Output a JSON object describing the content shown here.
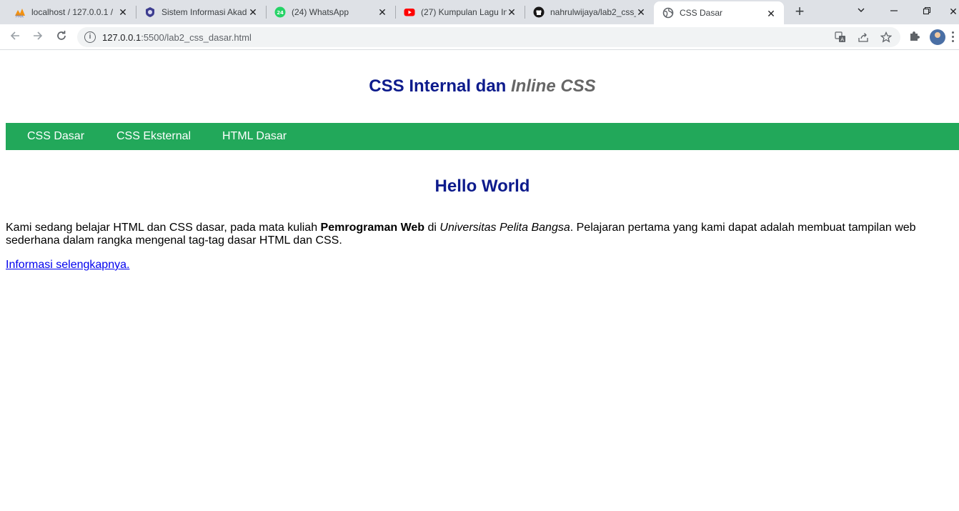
{
  "browser": {
    "tabs": [
      {
        "title": "localhost / 127.0.0.1 / ",
        "favicon": "phpmyadmin-icon",
        "active": false
      },
      {
        "title": "Sistem Informasi Akad",
        "favicon": "university-icon",
        "active": false
      },
      {
        "title": "(24) WhatsApp",
        "favicon": "whatsapp-icon",
        "badge": "24",
        "active": false
      },
      {
        "title": "(27) Kumpulan Lagu In",
        "favicon": "youtube-icon",
        "active": false
      },
      {
        "title": "nahrulwijaya/lab2_css_",
        "favicon": "github-icon",
        "active": false
      },
      {
        "title": "CSS Dasar",
        "favicon": "globe-icon",
        "active": true
      }
    ],
    "url_host": "127.0.0.1",
    "url_rest": ":5500/lab2_css_dasar.html",
    "accent_green": "#22a85a",
    "title_blue": "#0d1b8c"
  },
  "page": {
    "title_part1": "CSS Internal dan ",
    "title_part2": "Inline CSS",
    "nav": [
      "CSS Dasar",
      "CSS Eksternal",
      "HTML Dasar"
    ],
    "heading": "Hello World",
    "para_1": "Kami sedang belajar HTML dan CSS dasar, pada mata kuliah ",
    "para_bold": "Pemrograman Web",
    "para_2": " di ",
    "para_italic": "Universitas Pelita Bangsa",
    "para_3": ". Pelajaran pertama yang kami dapat adalah membuat tampilan web sederhana dalam rangka mengenal tag-tag dasar HTML dan CSS.",
    "link": "Informasi selengkapnya."
  }
}
